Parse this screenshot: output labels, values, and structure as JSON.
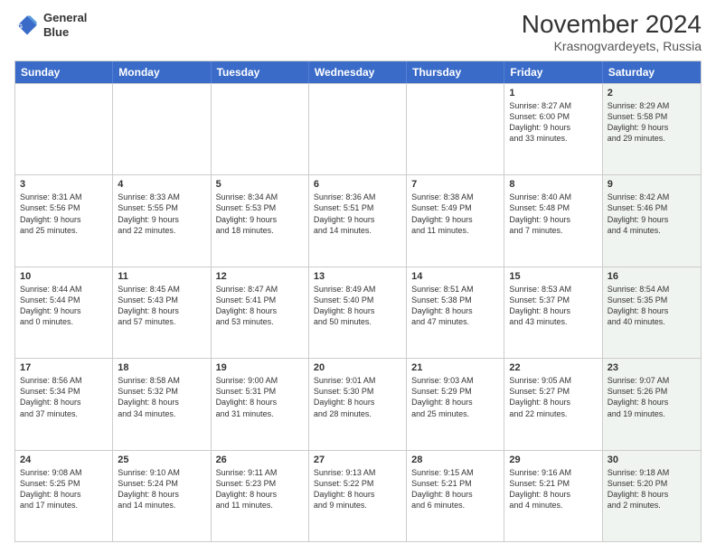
{
  "logo": {
    "line1": "General",
    "line2": "Blue"
  },
  "title": "November 2024",
  "subtitle": "Krasnogvardeyets, Russia",
  "header_days": [
    "Sunday",
    "Monday",
    "Tuesday",
    "Wednesday",
    "Thursday",
    "Friday",
    "Saturday"
  ],
  "rows": [
    [
      {
        "day": "",
        "info": "",
        "shaded": false
      },
      {
        "day": "",
        "info": "",
        "shaded": false
      },
      {
        "day": "",
        "info": "",
        "shaded": false
      },
      {
        "day": "",
        "info": "",
        "shaded": false
      },
      {
        "day": "",
        "info": "",
        "shaded": false
      },
      {
        "day": "1",
        "info": "Sunrise: 8:27 AM\nSunset: 6:00 PM\nDaylight: 9 hours\nand 33 minutes.",
        "shaded": false
      },
      {
        "day": "2",
        "info": "Sunrise: 8:29 AM\nSunset: 5:58 PM\nDaylight: 9 hours\nand 29 minutes.",
        "shaded": true
      }
    ],
    [
      {
        "day": "3",
        "info": "Sunrise: 8:31 AM\nSunset: 5:56 PM\nDaylight: 9 hours\nand 25 minutes.",
        "shaded": false
      },
      {
        "day": "4",
        "info": "Sunrise: 8:33 AM\nSunset: 5:55 PM\nDaylight: 9 hours\nand 22 minutes.",
        "shaded": false
      },
      {
        "day": "5",
        "info": "Sunrise: 8:34 AM\nSunset: 5:53 PM\nDaylight: 9 hours\nand 18 minutes.",
        "shaded": false
      },
      {
        "day": "6",
        "info": "Sunrise: 8:36 AM\nSunset: 5:51 PM\nDaylight: 9 hours\nand 14 minutes.",
        "shaded": false
      },
      {
        "day": "7",
        "info": "Sunrise: 8:38 AM\nSunset: 5:49 PM\nDaylight: 9 hours\nand 11 minutes.",
        "shaded": false
      },
      {
        "day": "8",
        "info": "Sunrise: 8:40 AM\nSunset: 5:48 PM\nDaylight: 9 hours\nand 7 minutes.",
        "shaded": false
      },
      {
        "day": "9",
        "info": "Sunrise: 8:42 AM\nSunset: 5:46 PM\nDaylight: 9 hours\nand 4 minutes.",
        "shaded": true
      }
    ],
    [
      {
        "day": "10",
        "info": "Sunrise: 8:44 AM\nSunset: 5:44 PM\nDaylight: 9 hours\nand 0 minutes.",
        "shaded": false
      },
      {
        "day": "11",
        "info": "Sunrise: 8:45 AM\nSunset: 5:43 PM\nDaylight: 8 hours\nand 57 minutes.",
        "shaded": false
      },
      {
        "day": "12",
        "info": "Sunrise: 8:47 AM\nSunset: 5:41 PM\nDaylight: 8 hours\nand 53 minutes.",
        "shaded": false
      },
      {
        "day": "13",
        "info": "Sunrise: 8:49 AM\nSunset: 5:40 PM\nDaylight: 8 hours\nand 50 minutes.",
        "shaded": false
      },
      {
        "day": "14",
        "info": "Sunrise: 8:51 AM\nSunset: 5:38 PM\nDaylight: 8 hours\nand 47 minutes.",
        "shaded": false
      },
      {
        "day": "15",
        "info": "Sunrise: 8:53 AM\nSunset: 5:37 PM\nDaylight: 8 hours\nand 43 minutes.",
        "shaded": false
      },
      {
        "day": "16",
        "info": "Sunrise: 8:54 AM\nSunset: 5:35 PM\nDaylight: 8 hours\nand 40 minutes.",
        "shaded": true
      }
    ],
    [
      {
        "day": "17",
        "info": "Sunrise: 8:56 AM\nSunset: 5:34 PM\nDaylight: 8 hours\nand 37 minutes.",
        "shaded": false
      },
      {
        "day": "18",
        "info": "Sunrise: 8:58 AM\nSunset: 5:32 PM\nDaylight: 8 hours\nand 34 minutes.",
        "shaded": false
      },
      {
        "day": "19",
        "info": "Sunrise: 9:00 AM\nSunset: 5:31 PM\nDaylight: 8 hours\nand 31 minutes.",
        "shaded": false
      },
      {
        "day": "20",
        "info": "Sunrise: 9:01 AM\nSunset: 5:30 PM\nDaylight: 8 hours\nand 28 minutes.",
        "shaded": false
      },
      {
        "day": "21",
        "info": "Sunrise: 9:03 AM\nSunset: 5:29 PM\nDaylight: 8 hours\nand 25 minutes.",
        "shaded": false
      },
      {
        "day": "22",
        "info": "Sunrise: 9:05 AM\nSunset: 5:27 PM\nDaylight: 8 hours\nand 22 minutes.",
        "shaded": false
      },
      {
        "day": "23",
        "info": "Sunrise: 9:07 AM\nSunset: 5:26 PM\nDaylight: 8 hours\nand 19 minutes.",
        "shaded": true
      }
    ],
    [
      {
        "day": "24",
        "info": "Sunrise: 9:08 AM\nSunset: 5:25 PM\nDaylight: 8 hours\nand 17 minutes.",
        "shaded": false
      },
      {
        "day": "25",
        "info": "Sunrise: 9:10 AM\nSunset: 5:24 PM\nDaylight: 8 hours\nand 14 minutes.",
        "shaded": false
      },
      {
        "day": "26",
        "info": "Sunrise: 9:11 AM\nSunset: 5:23 PM\nDaylight: 8 hours\nand 11 minutes.",
        "shaded": false
      },
      {
        "day": "27",
        "info": "Sunrise: 9:13 AM\nSunset: 5:22 PM\nDaylight: 8 hours\nand 9 minutes.",
        "shaded": false
      },
      {
        "day": "28",
        "info": "Sunrise: 9:15 AM\nSunset: 5:21 PM\nDaylight: 8 hours\nand 6 minutes.",
        "shaded": false
      },
      {
        "day": "29",
        "info": "Sunrise: 9:16 AM\nSunset: 5:21 PM\nDaylight: 8 hours\nand 4 minutes.",
        "shaded": false
      },
      {
        "day": "30",
        "info": "Sunrise: 9:18 AM\nSunset: 5:20 PM\nDaylight: 8 hours\nand 2 minutes.",
        "shaded": true
      }
    ]
  ]
}
